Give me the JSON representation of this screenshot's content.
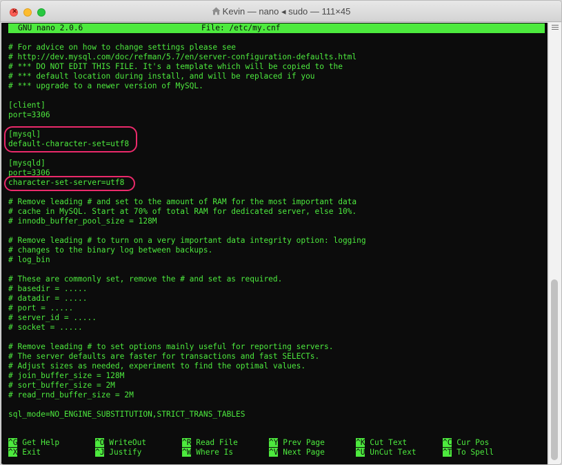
{
  "window": {
    "title": "Kevin — nano ◂ sudo — 111×45",
    "close_glyph": "×"
  },
  "nano": {
    "version": "GNU nano 2.0.6",
    "file": "File: /etc/my.cnf"
  },
  "lines": [
    "",
    "# For advice on how to change settings please see",
    "# http://dev.mysql.com/doc/refman/5.7/en/server-configuration-defaults.html",
    "# *** DO NOT EDIT THIS FILE. It's a template which will be copied to the",
    "# *** default location during install, and will be replaced if you",
    "# *** upgrade to a newer version of MySQL.",
    "",
    "[client]",
    "port=3306",
    "",
    "[mysql]",
    "default-character-set=utf8",
    "",
    "[mysqld]",
    "port=3306",
    "character-set-server=utf8",
    "",
    "# Remove leading # and set to the amount of RAM for the most important data",
    "# cache in MySQL. Start at 70% of total RAM for dedicated server, else 10%.",
    "# innodb_buffer_pool_size = 128M",
    "",
    "# Remove leading # to turn on a very important data integrity option: logging",
    "# changes to the binary log between backups.",
    "# log_bin",
    "",
    "# These are commonly set, remove the # and set as required.",
    "# basedir = .....",
    "# datadir = .....",
    "# port = .....",
    "# server_id = .....",
    "# socket = .....",
    "",
    "# Remove leading # to set options mainly useful for reporting servers.",
    "# The server defaults are faster for transactions and fast SELECTs.",
    "# Adjust sizes as needed, experiment to find the optimal values.",
    "# join_buffer_size = 128M",
    "# sort_buffer_size = 2M",
    "# read_rnd_buffer_size = 2M",
    "",
    "sql_mode=NO_ENGINE_SUBSTITUTION,STRICT_TRANS_TABLES"
  ],
  "shortcuts_row1": [
    {
      "key": "^G",
      "label": "Get Help"
    },
    {
      "key": "^O",
      "label": "WriteOut"
    },
    {
      "key": "^R",
      "label": "Read File"
    },
    {
      "key": "^Y",
      "label": "Prev Page"
    },
    {
      "key": "^K",
      "label": "Cut Text"
    },
    {
      "key": "^C",
      "label": "Cur Pos"
    }
  ],
  "shortcuts_row2": [
    {
      "key": "^X",
      "label": "Exit"
    },
    {
      "key": "^J",
      "label": "Justify"
    },
    {
      "key": "^W",
      "label": "Where Is"
    },
    {
      "key": "^V",
      "label": "Next Page"
    },
    {
      "key": "^U",
      "label": "UnCut Text"
    },
    {
      "key": "^T",
      "label": "To Spell"
    }
  ],
  "colors": {
    "terminal_bg": "#0c0c0c",
    "terminal_fg": "#4dea3e",
    "highlight": "#ec2a6b"
  }
}
